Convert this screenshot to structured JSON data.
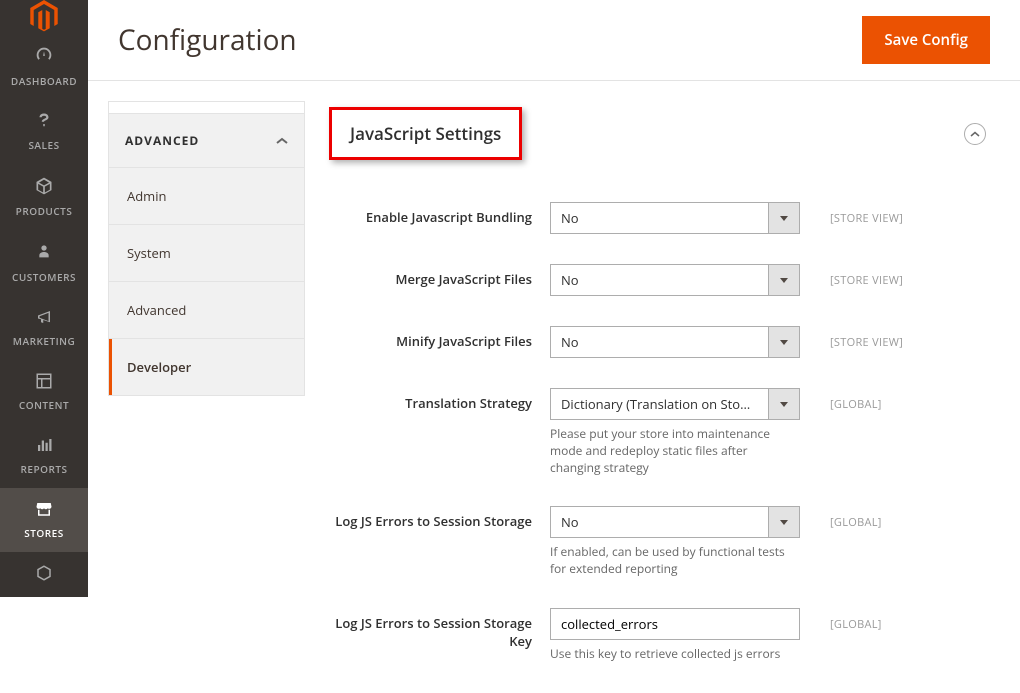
{
  "header": {
    "title": "Configuration",
    "save_button": "Save Config"
  },
  "sidebar_nav": [
    {
      "id": "dashboard",
      "label": "DASHBOARD"
    },
    {
      "id": "sales",
      "label": "SALES"
    },
    {
      "id": "products",
      "label": "PRODUCTS"
    },
    {
      "id": "customers",
      "label": "CUSTOMERS"
    },
    {
      "id": "marketing",
      "label": "MARKETING"
    },
    {
      "id": "content",
      "label": "CONTENT"
    },
    {
      "id": "reports",
      "label": "REPORTS"
    },
    {
      "id": "stores",
      "label": "STORES",
      "active": true
    }
  ],
  "config_nav": {
    "group": "ADVANCED",
    "items": [
      {
        "label": "Admin"
      },
      {
        "label": "System"
      },
      {
        "label": "Advanced"
      },
      {
        "label": "Developer",
        "active": true
      }
    ]
  },
  "section": {
    "title": "JavaScript Settings"
  },
  "fields": {
    "bundling": {
      "label": "Enable Javascript Bundling",
      "value": "No",
      "scope": "[STORE VIEW]"
    },
    "merge": {
      "label": "Merge JavaScript Files",
      "value": "No",
      "scope": "[STORE VIEW]"
    },
    "minify": {
      "label": "Minify JavaScript Files",
      "value": "No",
      "scope": "[STORE VIEW]"
    },
    "translation": {
      "label": "Translation Strategy",
      "value": "Dictionary (Translation on Storefront side)",
      "scope": "[GLOBAL]",
      "note": "Please put your store into maintenance mode and redeploy static files after changing strategy"
    },
    "logjs": {
      "label": "Log JS Errors to Session Storage",
      "value": "No",
      "scope": "[GLOBAL]",
      "note": "If enabled, can be used by functional tests for extended reporting"
    },
    "logjskey": {
      "label": "Log JS Errors to Session Storage Key",
      "value": "collected_errors",
      "scope": "[GLOBAL]",
      "note": "Use this key to retrieve collected js errors"
    }
  }
}
